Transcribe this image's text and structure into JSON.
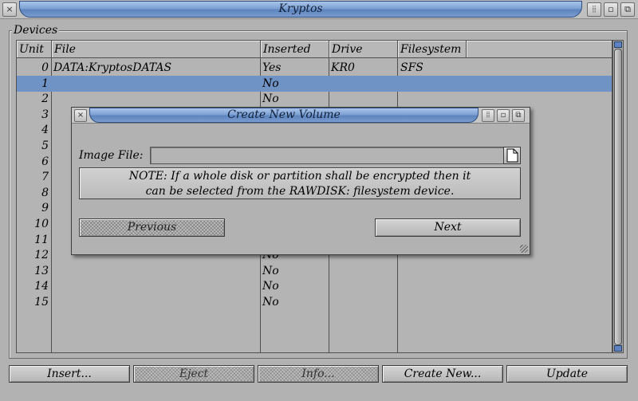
{
  "window": {
    "title": "Kryptos",
    "close_glyph": "×",
    "menu_glyph": "⦙⦙",
    "zoom_glyph": "▫",
    "depth_glyph": "⧉"
  },
  "devices": {
    "label": "Devices",
    "columns": [
      "Unit",
      "File",
      "Inserted",
      "Drive",
      "Filesystem"
    ],
    "rows": [
      {
        "unit": "0",
        "file": "DATA:KryptosDATAS",
        "inserted": "Yes",
        "drive": "KR0",
        "fs": "SFS"
      },
      {
        "unit": "1",
        "file": "",
        "inserted": "No",
        "drive": "",
        "fs": ""
      },
      {
        "unit": "2",
        "file": "",
        "inserted": "No",
        "drive": "",
        "fs": ""
      },
      {
        "unit": "3",
        "file": "",
        "inserted": "",
        "drive": "",
        "fs": ""
      },
      {
        "unit": "4",
        "file": "",
        "inserted": "",
        "drive": "",
        "fs": ""
      },
      {
        "unit": "5",
        "file": "",
        "inserted": "",
        "drive": "",
        "fs": ""
      },
      {
        "unit": "6",
        "file": "",
        "inserted": "",
        "drive": "",
        "fs": ""
      },
      {
        "unit": "7",
        "file": "",
        "inserted": "",
        "drive": "",
        "fs": ""
      },
      {
        "unit": "8",
        "file": "",
        "inserted": "",
        "drive": "",
        "fs": ""
      },
      {
        "unit": "9",
        "file": "",
        "inserted": "",
        "drive": "",
        "fs": ""
      },
      {
        "unit": "10",
        "file": "",
        "inserted": "",
        "drive": "",
        "fs": ""
      },
      {
        "unit": "11",
        "file": "",
        "inserted": "",
        "drive": "",
        "fs": ""
      },
      {
        "unit": "12",
        "file": "",
        "inserted": "No",
        "drive": "",
        "fs": ""
      },
      {
        "unit": "13",
        "file": "",
        "inserted": "No",
        "drive": "",
        "fs": ""
      },
      {
        "unit": "14",
        "file": "",
        "inserted": "No",
        "drive": "",
        "fs": ""
      },
      {
        "unit": "15",
        "file": "",
        "inserted": "No",
        "drive": "",
        "fs": ""
      }
    ],
    "selected_unit": "1"
  },
  "buttons": {
    "insert": "Insert...",
    "eject": "Eject",
    "info": "Info...",
    "create_new": "Create New...",
    "update": "Update"
  },
  "dialog": {
    "title": "Create New Volume",
    "image_file_label": "Image File:",
    "image_file_value": "",
    "note_line1": "NOTE: If a whole disk or partition shall be encrypted then it",
    "note_line2": "can be selected from the RAWDISK: filesystem device.",
    "previous": "Previous",
    "next": "Next"
  },
  "colors": {
    "selection": "#6f93c5",
    "titlebar_blue": "#7fa2d3",
    "background": "#b2b2b2"
  }
}
